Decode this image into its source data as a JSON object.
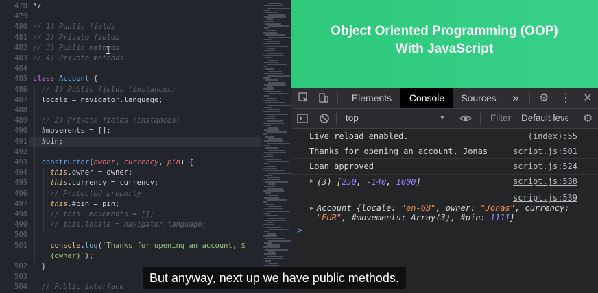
{
  "editor": {
    "lines": [
      {
        "n": "478",
        "segs": [
          [
            "pl",
            "*/"
          ]
        ],
        "indent": 0
      },
      {
        "n": "479",
        "segs": [],
        "indent": 0
      },
      {
        "n": "480",
        "segs": [
          [
            "cm",
            "// 1) Public fields"
          ]
        ],
        "indent": 0
      },
      {
        "n": "481",
        "segs": [
          [
            "cm",
            "// 2) Private fields"
          ]
        ],
        "indent": 0
      },
      {
        "n": "482",
        "segs": [
          [
            "cm",
            "// 3) Public methods"
          ]
        ],
        "indent": 0
      },
      {
        "n": "483",
        "segs": [
          [
            "cm",
            "// 4) Private methods"
          ]
        ],
        "indent": 0
      },
      {
        "n": "484",
        "segs": [],
        "indent": 0
      },
      {
        "n": "485",
        "segs": [
          [
            "kw",
            "class "
          ],
          [
            "cls",
            "Account"
          ],
          [
            "pl",
            " {"
          ]
        ],
        "indent": 0
      },
      {
        "n": "486",
        "segs": [
          [
            "cm",
            "// 1) Public fields (instances)"
          ]
        ],
        "indent": 1
      },
      {
        "n": "487",
        "segs": [
          [
            "pl",
            "locale = "
          ],
          [
            "pl",
            "navigator"
          ],
          [
            "pl",
            "."
          ],
          [
            "pl",
            "language;"
          ]
        ],
        "indent": 1
      },
      {
        "n": "488",
        "segs": [],
        "indent": 1
      },
      {
        "n": "489",
        "segs": [
          [
            "cm",
            "// 2) Private fields (instances)"
          ]
        ],
        "indent": 1
      },
      {
        "n": "490",
        "segs": [
          [
            "pl",
            "#movements = [];"
          ]
        ],
        "indent": 1
      },
      {
        "n": "491",
        "segs": [
          [
            "pl",
            "#pin;"
          ]
        ],
        "indent": 1
      },
      {
        "n": "492",
        "segs": [],
        "indent": 1
      },
      {
        "n": "493",
        "segs": [
          [
            "fn",
            "constructor"
          ],
          [
            "pl",
            "("
          ],
          [
            "prm",
            "owner"
          ],
          [
            "pl",
            ", "
          ],
          [
            "prm",
            "currency"
          ],
          [
            "pl",
            ", "
          ],
          [
            "prm",
            "pin"
          ],
          [
            "pl",
            ") {"
          ]
        ],
        "indent": 1
      },
      {
        "n": "494",
        "segs": [
          [
            "this",
            "this"
          ],
          [
            "pl",
            ".owner = owner;"
          ]
        ],
        "indent": 2
      },
      {
        "n": "495",
        "segs": [
          [
            "this",
            "this"
          ],
          [
            "pl",
            ".currency = currency;"
          ]
        ],
        "indent": 2
      },
      {
        "n": "496",
        "segs": [
          [
            "cm",
            "// Protected property"
          ]
        ],
        "indent": 2
      },
      {
        "n": "497",
        "segs": [
          [
            "this",
            "this"
          ],
          [
            "pl",
            ".#pin = pin;"
          ]
        ],
        "indent": 2
      },
      {
        "n": "498",
        "segs": [
          [
            "cm",
            "// this._movements = [];"
          ]
        ],
        "indent": 2
      },
      {
        "n": "499",
        "segs": [
          [
            "cm",
            "// this.locale = navigator.language;"
          ]
        ],
        "indent": 2
      },
      {
        "n": "500",
        "segs": [],
        "indent": 2
      },
      {
        "n": "501",
        "segs": [
          [
            "obj",
            "console"
          ],
          [
            "pl",
            "."
          ],
          [
            "fn",
            "log"
          ],
          [
            "pl",
            "("
          ],
          [
            "str",
            "`Thanks for opening an account, $"
          ]
        ],
        "indent": 2
      },
      {
        "n": "",
        "segs": [
          [
            "str",
            "{owner}`"
          ],
          [
            "pl",
            ");"
          ]
        ],
        "indent": 2
      },
      {
        "n": "502",
        "segs": [
          [
            "pl",
            "}"
          ]
        ],
        "indent": 1
      },
      {
        "n": "503",
        "segs": [],
        "indent": 1
      },
      {
        "n": "504",
        "segs": [
          [
            "cm",
            "// Public interface"
          ]
        ],
        "indent": 1
      }
    ]
  },
  "banner": {
    "title": "Object Oriented Programming (OOP)\nWith JavaScript"
  },
  "devtools": {
    "tabs": [
      "Elements",
      "Console",
      "Sources"
    ],
    "active_tab": "Console",
    "more_label": "»",
    "context": "top",
    "filter_placeholder": "Filter",
    "levels": "Default leve",
    "logs": [
      {
        "msg": "Live reload enabled.",
        "src": "(index):55"
      },
      {
        "msg": "Thanks for opening an account, Jonas",
        "src": "script.js:501"
      },
      {
        "msg": "Loan approved",
        "src": "script.js:524"
      },
      {
        "msg_array": {
          "prefix": "(3) [",
          "items": [
            "250",
            "-140",
            "1000"
          ],
          "suffix": "]"
        },
        "src": "script.js:538"
      },
      {
        "src": "script.js:539",
        "object": {
          "line1_name": "Account {",
          "line1_k1": "locale: ",
          "line1_v1": "\"en-GB\"",
          "line1_k2": ", owner: ",
          "line1_v2": "\"Jonas\"",
          "line1_k3": ", currency:",
          "line2_v3": "\"EUR\"",
          "line2_rest": ", #movements: Array(3), #pin: ",
          "line2_pin": "1111",
          "line2_end": "}"
        }
      }
    ],
    "prompt": ">"
  },
  "subtitle": "But anyway, next up we have public methods.",
  "colors": {
    "banner_green": "#2ec97a",
    "console_number": "#9980ff",
    "console_string": "#f28b54",
    "prompt_blue": "#4aa3ff"
  }
}
